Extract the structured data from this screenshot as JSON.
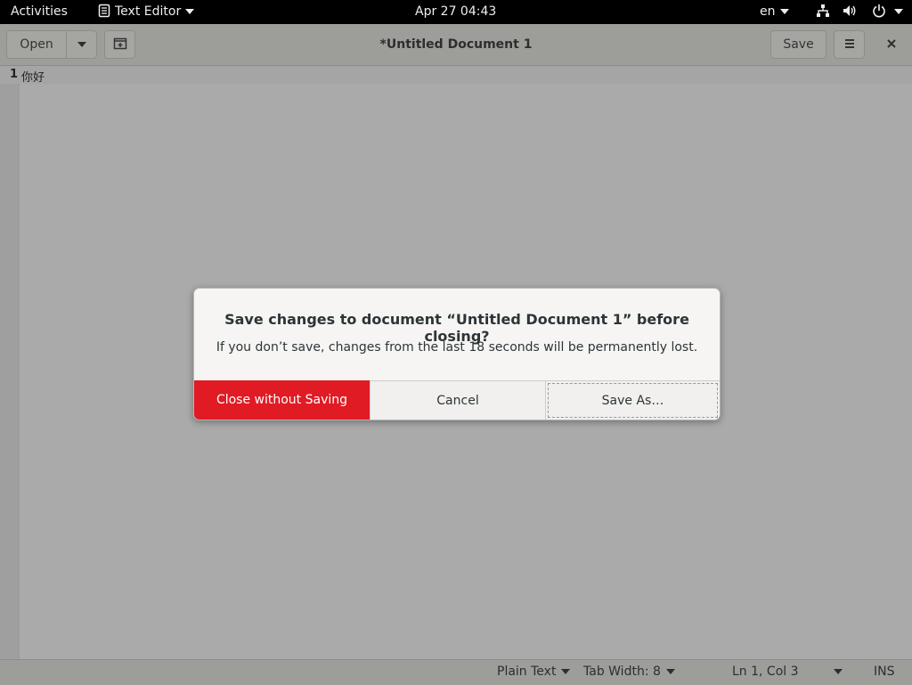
{
  "topbar": {
    "activities": "Activities",
    "app_menu": "Text Editor",
    "clock": "Apr 27  04:43",
    "language": "en",
    "icons": [
      "network-icon",
      "volume-icon",
      "power-icon"
    ]
  },
  "header": {
    "open_label": "Open",
    "title": "*Untitled Document 1",
    "save_label": "Save"
  },
  "editor": {
    "line_number": "1",
    "line_text": "你好"
  },
  "statusbar": {
    "language": "Plain Text",
    "tab_width": "Tab Width: 8",
    "position": "Ln 1, Col 3",
    "mode": "INS"
  },
  "dialog": {
    "title": "Save changes to document “Untitled Document 1” before closing?",
    "message": "If you don’t save, changes from the last 18 seconds will be permanently lost.",
    "close_without_saving": "Close without Saving",
    "cancel": "Cancel",
    "save_as": "Save As…"
  },
  "colors": {
    "destructive": "#e01b24",
    "dialog_bg": "#f6f5f4",
    "topbar_bg": "#000000"
  }
}
